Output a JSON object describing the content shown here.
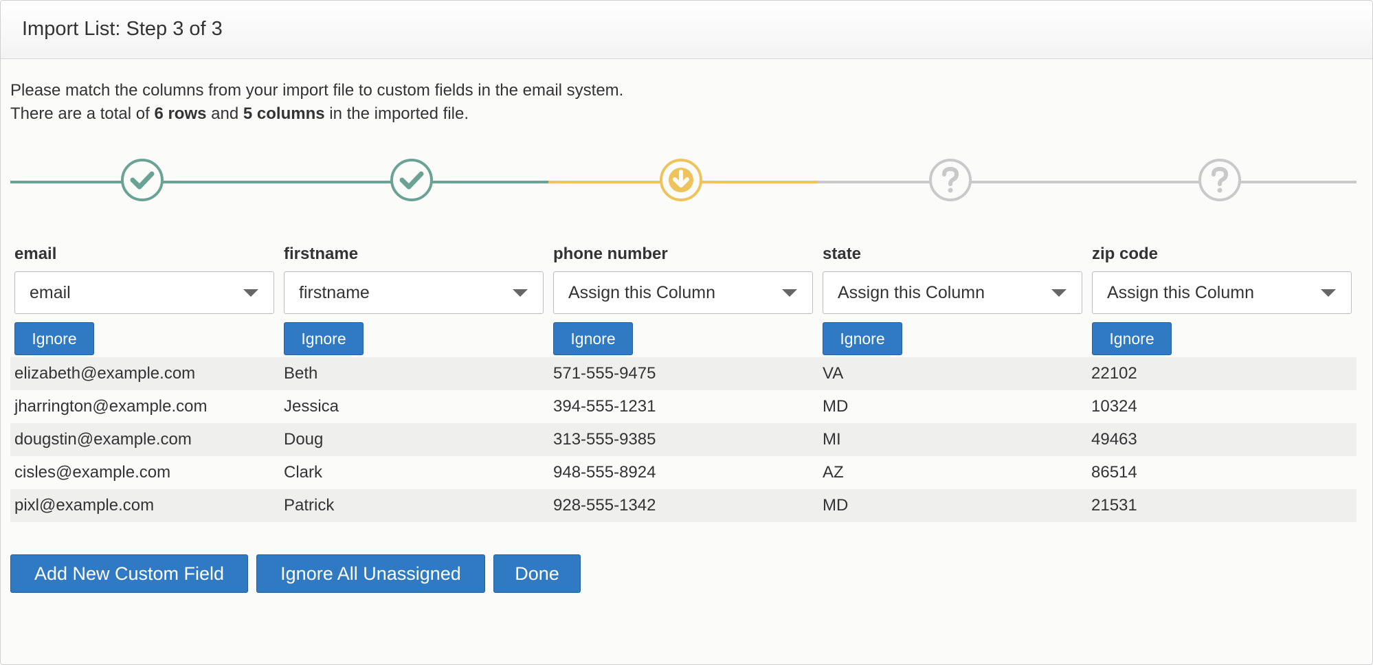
{
  "header": {
    "title": "Import List: Step 3 of 3"
  },
  "intro": {
    "line1": "Please match the columns from your import file to custom fields in the email system.",
    "line2_prefix": "There are a total of ",
    "rows_count": "6 rows",
    "line2_mid": " and ",
    "cols_count": "5 columns",
    "line2_suffix": " in the imported file."
  },
  "stepper": {
    "colors": {
      "done": "#6aa394",
      "current": "#eec35c",
      "pending": "#c9c9c9"
    },
    "steps": [
      {
        "status": "done",
        "icon": "check-icon"
      },
      {
        "status": "done",
        "icon": "check-icon"
      },
      {
        "status": "current",
        "icon": "arrow-down-icon"
      },
      {
        "status": "pending",
        "icon": "question-icon"
      },
      {
        "status": "pending",
        "icon": "question-icon"
      }
    ]
  },
  "columns": [
    {
      "header": "email",
      "selected": "email",
      "ignore_label": "Ignore"
    },
    {
      "header": "firstname",
      "selected": "firstname",
      "ignore_label": "Ignore"
    },
    {
      "header": "phone number",
      "selected": "Assign this Column",
      "ignore_label": "Ignore"
    },
    {
      "header": "state",
      "selected": "Assign this Column",
      "ignore_label": "Ignore"
    },
    {
      "header": "zip code",
      "selected": "Assign this Column",
      "ignore_label": "Ignore"
    }
  ],
  "rows": [
    [
      "elizabeth@example.com",
      "Beth",
      "571-555-9475",
      "VA",
      "22102"
    ],
    [
      "jharrington@example.com",
      "Jessica",
      "394-555-1231",
      "MD",
      "10324"
    ],
    [
      "dougstin@example.com",
      "Doug",
      "313-555-9385",
      "MI",
      "49463"
    ],
    [
      "cisles@example.com",
      "Clark",
      "948-555-8924",
      "AZ",
      "86514"
    ],
    [
      "pixl@example.com",
      "Patrick",
      "928-555-1342",
      "MD",
      "21531"
    ]
  ],
  "actions": {
    "add_field": "Add New Custom Field",
    "ignore_all": "Ignore All Unassigned",
    "done": "Done"
  },
  "colors": {
    "primary_button": "#2f7ac2"
  }
}
